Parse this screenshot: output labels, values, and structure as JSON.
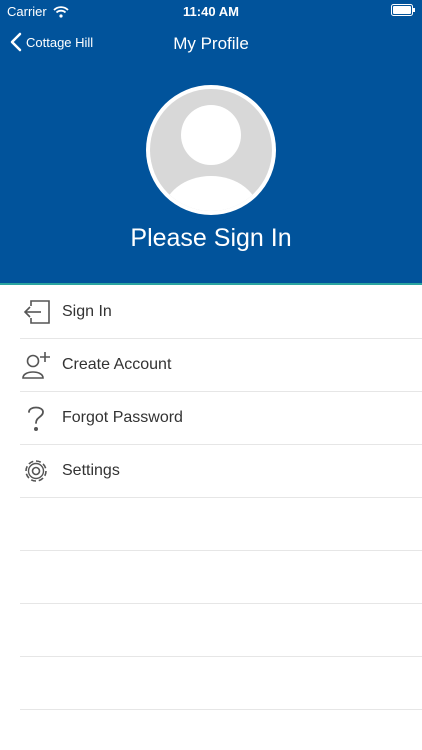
{
  "status_bar": {
    "carrier": "Carrier",
    "time": "11:40 AM"
  },
  "nav": {
    "back_label": "Cottage Hill",
    "title": "My Profile"
  },
  "profile": {
    "prompt": "Please Sign In"
  },
  "menu": [
    {
      "label": "Sign In",
      "icon": "sign-in-icon"
    },
    {
      "label": "Create Account",
      "icon": "add-user-icon"
    },
    {
      "label": "Forgot Password",
      "icon": "question-icon"
    },
    {
      "label": "Settings",
      "icon": "gear-icon"
    }
  ],
  "colors": {
    "header": "#01539b",
    "accent_line": "#2aa4a0",
    "icon": "#555555"
  }
}
